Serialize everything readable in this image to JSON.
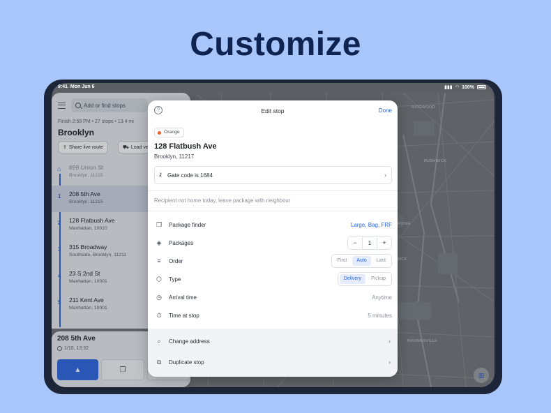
{
  "headline": "Customize",
  "status": {
    "time": "9:41",
    "date": "Mon Jun 6",
    "battery": "100%"
  },
  "left": {
    "search_placeholder": "Add or find stops",
    "meta": "Finish 2:59 PM • 27 stops • 13.4 mi",
    "city": "Brooklyn",
    "share_label": "Share live route",
    "load_label": "Load ve",
    "stops": [
      {
        "num": "",
        "addr": "898 Union St",
        "sub": "Brooklyn, 11215"
      },
      {
        "num": "1",
        "addr": "208 5th Ave",
        "sub": "Brooklyn, 11215"
      },
      {
        "num": "2",
        "addr": "128 Flatbush Ave",
        "sub": "Manhattan, 10010"
      },
      {
        "num": "3",
        "addr": "315 Broadway",
        "sub": "Southside, Brooklyn, 11211"
      },
      {
        "num": "4",
        "addr": "23 S 2nd St",
        "sub": "Manhattan, 10001"
      },
      {
        "num": "5",
        "addr": "211 Kent Ave",
        "sub": "Manhattan, 10001"
      }
    ],
    "card": {
      "title": "208 5th Ave",
      "sub": "1/10, 13:32"
    }
  },
  "map": {
    "labels": [
      "RIDGWOOD",
      "BUSHWICK",
      "RIDGE",
      "WICK",
      "BROWNSVILLE"
    ]
  },
  "modal": {
    "title": "Edit stop",
    "done": "Done",
    "tag": "Orange",
    "address": "128 Flatbush Ave",
    "address2": "Brooklyn, 11217",
    "gate": "Gate code is 1684",
    "note": "Recipient not home today, leave package with neighbour",
    "package_finder": {
      "label": "Package finder",
      "value": "Large, Bag, FRF"
    },
    "packages": {
      "label": "Packages",
      "minus": "−",
      "count": "1",
      "plus": "+"
    },
    "order": {
      "label": "Order",
      "options": [
        "First",
        "Auto",
        "Last"
      ],
      "selected": "Auto"
    },
    "type": {
      "label": "Type",
      "options": [
        "Delivery",
        "Pickup"
      ],
      "selected": "Delivery"
    },
    "arrival": {
      "label": "Arrival time",
      "value": "Anytime"
    },
    "time_at_stop": {
      "label": "Time at stop",
      "value": "5 minutes"
    },
    "change_address": "Change address",
    "duplicate_stop": "Duplicate stop"
  },
  "colors": {
    "accent": "#2b66e0",
    "background": "#a9c6fb",
    "headline": "#0f2350",
    "tag_dot": "#e8622c"
  }
}
